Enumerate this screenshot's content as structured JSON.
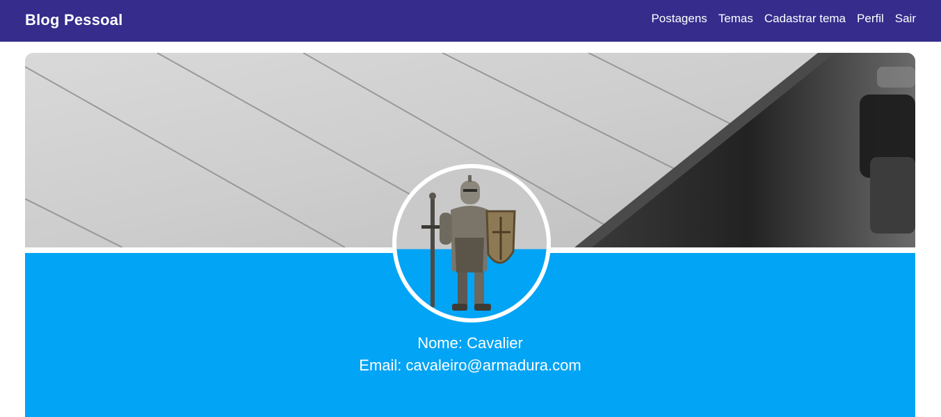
{
  "header": {
    "brand": "Blog Pessoal",
    "nav": [
      {
        "label": "Postagens"
      },
      {
        "label": "Temas"
      },
      {
        "label": "Cadastrar tema"
      },
      {
        "label": "Perfil"
      },
      {
        "label": "Sair"
      }
    ]
  },
  "profile": {
    "name_line": "Nome: Cavalier",
    "email_line": "Email: cavaleiro@armadura.com",
    "avatar_icon": "knight-icon",
    "cover_image": "notebook-cover-image"
  },
  "colors": {
    "navbar": "#352c8c",
    "panel": "#02a4f5",
    "text": "#ffffff"
  }
}
